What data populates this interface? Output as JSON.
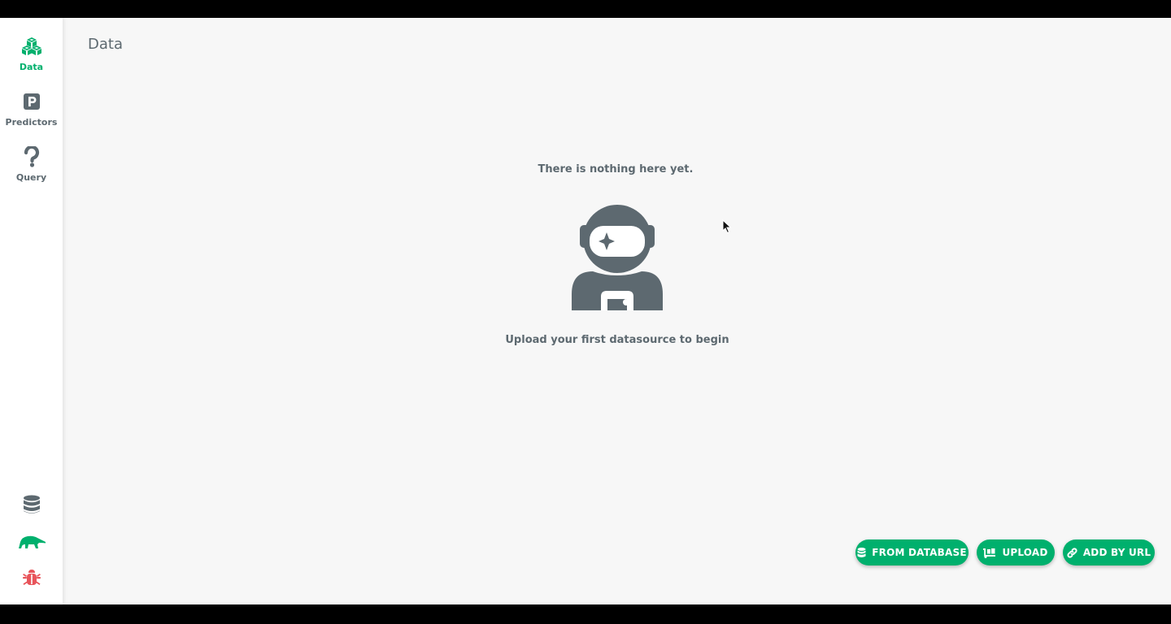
{
  "sidebar": {
    "items": [
      {
        "label": "Data",
        "icon": "cubes-icon",
        "active": true
      },
      {
        "label": "Predictors",
        "icon": "predictor-p-icon",
        "active": false
      },
      {
        "label": "Query",
        "icon": "question-icon",
        "active": false
      }
    ],
    "bottom": [
      {
        "icon": "database-icon"
      },
      {
        "icon": "anteater-logo-icon"
      },
      {
        "icon": "bug-icon"
      }
    ]
  },
  "header": {
    "title": "Data"
  },
  "empty_state": {
    "title": "There is nothing here yet.",
    "subtitle": "Upload your first datasource to begin",
    "illustration": "astronaut-icon"
  },
  "actions": {
    "from_database": "FROM DATABASE",
    "upload": "UPLOAD",
    "add_by_url": "ADD BY URL"
  },
  "colors": {
    "accent": "#00b06d",
    "text": "#5d6970",
    "bug": "#e8545a",
    "background": "#f7f7f7"
  }
}
